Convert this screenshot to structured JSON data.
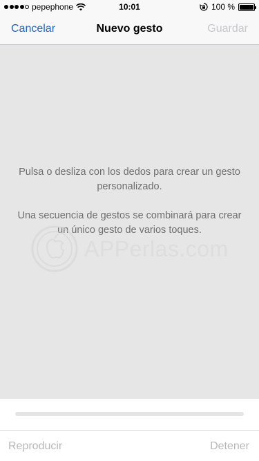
{
  "status_bar": {
    "carrier": "pepephone",
    "time": "10:01",
    "battery_percent": "100 %",
    "signal_bars_filled": 4,
    "signal_bars_total": 5,
    "battery_level": 1.0
  },
  "nav": {
    "cancel_label": "Cancelar",
    "title": "Nuevo gesto",
    "save_label": "Guardar"
  },
  "canvas": {
    "instruction_line1": "Pulsa o desliza con los dedos para crear un gesto personalizado.",
    "instruction_line2": "Una secuencia de gestos se combinará para crear un único gesto de varios toques.",
    "watermark_text": "APPerlas.com"
  },
  "playback": {
    "progress": 0,
    "play_label": "Reproducir",
    "stop_label": "Detener"
  },
  "colors": {
    "accent": "#1a63c7",
    "disabled": "#c7c7cc",
    "canvas_bg": "#e6e6e6"
  }
}
